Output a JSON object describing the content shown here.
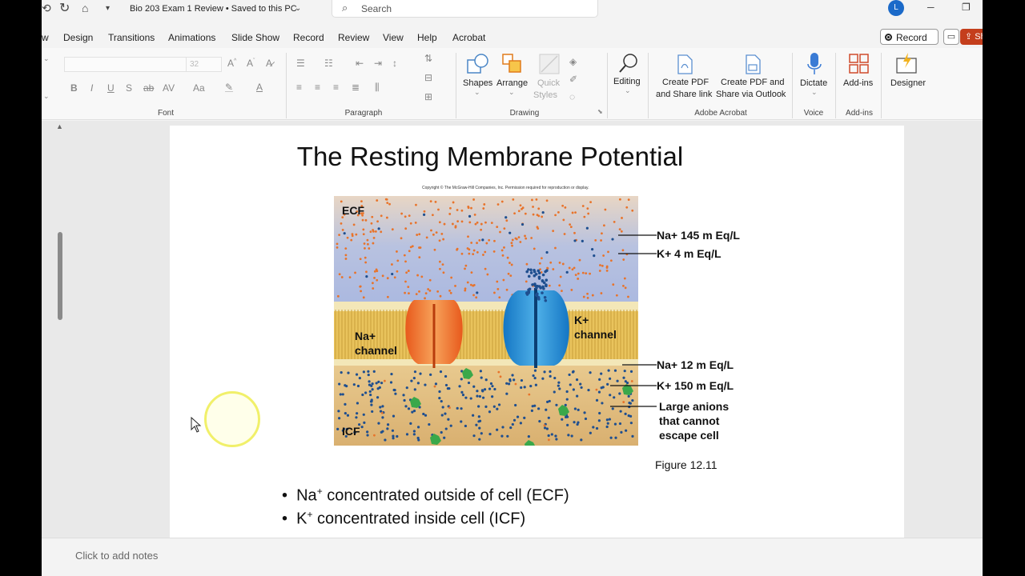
{
  "titlebar": {
    "doc_title": "Bio 203 Exam 1 Review • Saved to this PC",
    "search_placeholder": "Search",
    "avatar_initial": "L"
  },
  "menu": {
    "tabs": [
      "w",
      "Design",
      "Transitions",
      "Animations",
      "Slide Show",
      "Record",
      "Review",
      "View",
      "Help",
      "Acrobat"
    ],
    "record_button": "Record",
    "share_button": "Sh"
  },
  "ribbon": {
    "font_size": "32",
    "font_group": "Font",
    "paragraph_group": "Paragraph",
    "drawing_group": "Drawing",
    "shapes": "Shapes",
    "arrange": "Arrange",
    "quick_styles_1": "Quick",
    "quick_styles_2": "Styles",
    "editing": "Editing",
    "create_pdf_share_1": "Create PDF",
    "create_pdf_share_2": "and Share link",
    "create_pdf_outlook_1": "Create PDF and",
    "create_pdf_outlook_2": "Share via Outlook",
    "adobe_group": "Adobe Acrobat",
    "dictate": "Dictate",
    "voice_group": "Voice",
    "addins": "Add-ins",
    "addins_group": "Add-ins",
    "designer": "Designer"
  },
  "slide": {
    "title": "The Resting Membrane Potential",
    "copyright": "Copyright © The McGraw-Hill Companies, Inc. Permission required for reproduction or display.",
    "ecf": "ECF",
    "icf": "ICF",
    "na_channel_1": "Na+",
    "na_channel_2": "channel",
    "k_channel_1": "K+",
    "k_channel_2": "channel",
    "ecf_na": "Na+  145 m Eq/L",
    "ecf_k": "K+       4 m Eq/L",
    "icf_na": "Na+   12 m Eq/L",
    "icf_k": "K+   150 m Eq/L",
    "anions_1": "Large anions",
    "anions_2": "that cannot",
    "anions_3": "escape cell",
    "caption": "Figure 12.11",
    "bullet_1_rest": " concentrated outside of cell (ECF)",
    "bullet_2_rest": " concentrated inside cell (ICF)"
  },
  "notes": {
    "placeholder": "Click to add notes"
  },
  "colors": {
    "accent": "#c43e1c",
    "avatar": "#1b6ac9",
    "ion_na": "#e8732a",
    "ion_k": "#1f4f8f",
    "membrane": "#e8c15a"
  }
}
